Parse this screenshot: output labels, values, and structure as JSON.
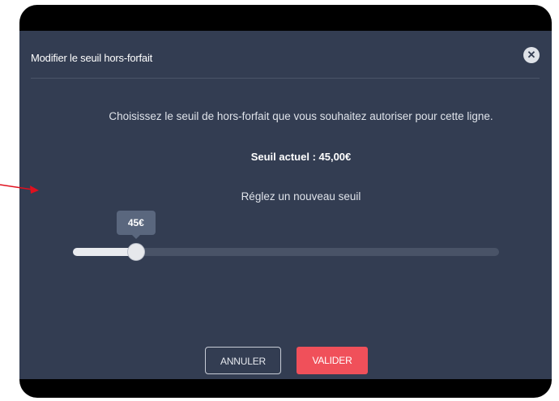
{
  "modal": {
    "title": "Modifier le seuil hors-forfait",
    "close_icon": "close-icon",
    "intro": "Choisissez le seuil de hors-forfait que vous souhaitez autoriser pour cette ligne.",
    "current_threshold": "Seuil actuel : 45,00€",
    "set_label": "Réglez un nouveau seuil"
  },
  "slider": {
    "value_label": "45€",
    "fraction": 0.148
  },
  "buttons": {
    "cancel": "ANNULER",
    "validate": "VALIDER"
  },
  "colors": {
    "modal_bg": "#333d52",
    "validate_bg": "#f0505a",
    "annotation_arrow": "#e0101e"
  },
  "annotation": {
    "icon": "pointer-arrow-icon"
  }
}
